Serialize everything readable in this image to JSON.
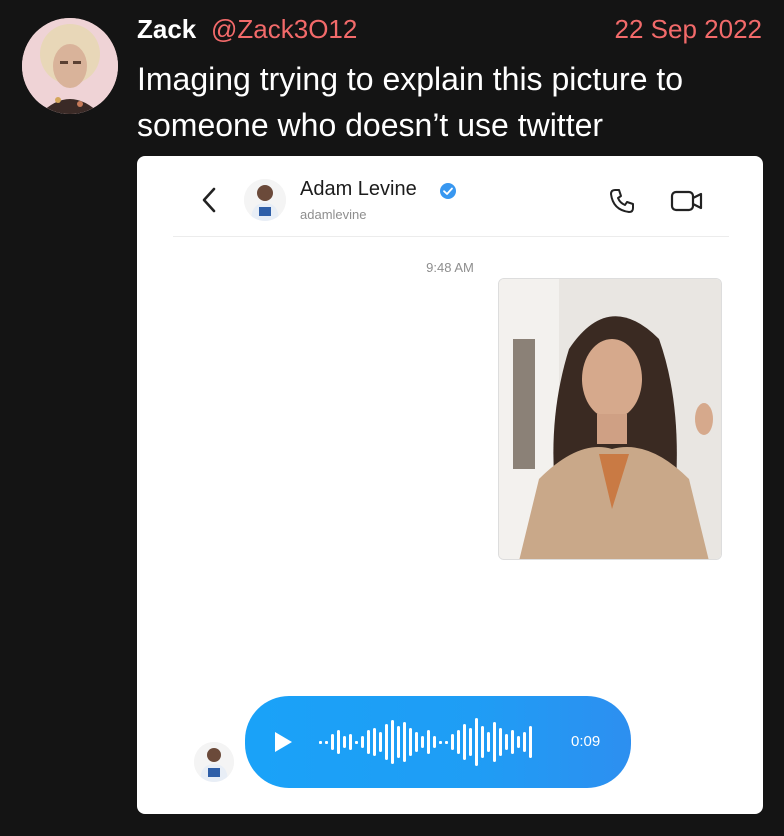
{
  "tweet": {
    "author_name": "Zack",
    "author_handle": "@Zack3O12",
    "date": "22 Sep 2022",
    "text": "Imaging trying to explain this picture to someone who doesn’t use twitter",
    "accent_color": "#f26a6a"
  },
  "dm": {
    "contact_name": "Adam Levine",
    "contact_username": "adamlevine",
    "timestamp": "9:48 AM",
    "voice_message": {
      "duration": "0:09",
      "bubble_color": "#1aa2f8"
    },
    "icons": [
      "back-chevron-icon",
      "verified-badge-icon",
      "phone-icon",
      "video-camera-icon",
      "play-icon"
    ]
  }
}
